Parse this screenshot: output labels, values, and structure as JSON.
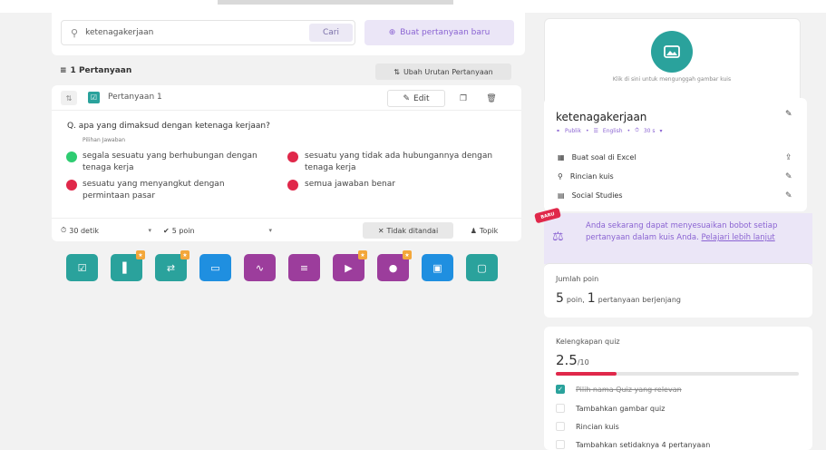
{
  "search": {
    "value": "ketenagakerjaan",
    "button": "Cari"
  },
  "new_question_button": "Buat pertanyaan baru",
  "question_count": "1 Pertanyaan",
  "reorder_button": "Ubah Urutan Pertanyaan",
  "question": {
    "label": "Pertanyaan 1",
    "edit": "Edit",
    "text": "Q. apa yang dimaksud dengan ketenaga kerjaan?",
    "answers_label": "Pilihan Jawaban",
    "answers": [
      {
        "text": "segala sesuatu yang berhubungan dengan tenaga kerja",
        "color": "#2ecc71"
      },
      {
        "text": "sesuatu yang tidak ada hubungannya dengan tenaga kerja",
        "color": "#e0284a"
      },
      {
        "text": "sesuatu yang menyangkut dengan permintaan pasar",
        "color": "#e0284a"
      },
      {
        "text": "semua jawaban benar",
        "color": "#e0284a"
      }
    ],
    "time": "30 detik",
    "points": "5 poin",
    "untagged": "Tidak ditandai",
    "topic": "Topik"
  },
  "question_types": [
    {
      "icon": "checkbox-icon",
      "color": "#2aa29c",
      "badge": false
    },
    {
      "icon": "poll-icon",
      "color": "#2aa29c",
      "badge": true
    },
    {
      "icon": "reorder-icon",
      "color": "#2aa29c",
      "badge": true
    },
    {
      "icon": "fill-blank-icon",
      "color": "#1f8fe0",
      "badge": false
    },
    {
      "icon": "draw-icon",
      "color": "#9c3d9c",
      "badge": false
    },
    {
      "icon": "open-ended-icon",
      "color": "#9c3d9c",
      "badge": false
    },
    {
      "icon": "video-icon",
      "color": "#9c3d9c",
      "badge": true
    },
    {
      "icon": "audio-icon",
      "color": "#9c3d9c",
      "badge": true
    },
    {
      "icon": "slide-icon",
      "color": "#1f8fe0",
      "badge": false
    },
    {
      "icon": "screen-icon",
      "color": "#2aa29c",
      "badge": false
    }
  ],
  "upload_image_text": "Klik di sini untuk mengunggah gambar kuis",
  "quiz": {
    "title": "ketenagakerjaan",
    "visibility": "Publik",
    "language": "English",
    "time": "30 s"
  },
  "actions": [
    {
      "label": "Buat soal di Excel"
    },
    {
      "label": "Rincian kuis"
    },
    {
      "label": "Social Studies"
    }
  ],
  "promo": {
    "badge": "BARU",
    "text": "Anda sekarang dapat menyesuaikan bobot setiap pertanyaan dalam kuis Anda.",
    "link": "Pelajari lebih lanjut"
  },
  "points": {
    "label": "Jumlah poin",
    "points_value": "5",
    "points_unit": "poin,",
    "questions_value": "1",
    "questions_unit": "pertanyaan berjenjang"
  },
  "completeness": {
    "label": "Kelengkapan quiz",
    "score": "2.5",
    "max": "/10",
    "fraction": 0.25,
    "items": [
      {
        "label": "Pilih nama Quiz yang relevan",
        "done": true
      },
      {
        "label": "Tambahkan gambar quiz",
        "done": false
      },
      {
        "label": "Rincian kuis",
        "done": false
      },
      {
        "label": "Tambahkan setidaknya 4 pertanyaan",
        "done": false
      }
    ]
  }
}
